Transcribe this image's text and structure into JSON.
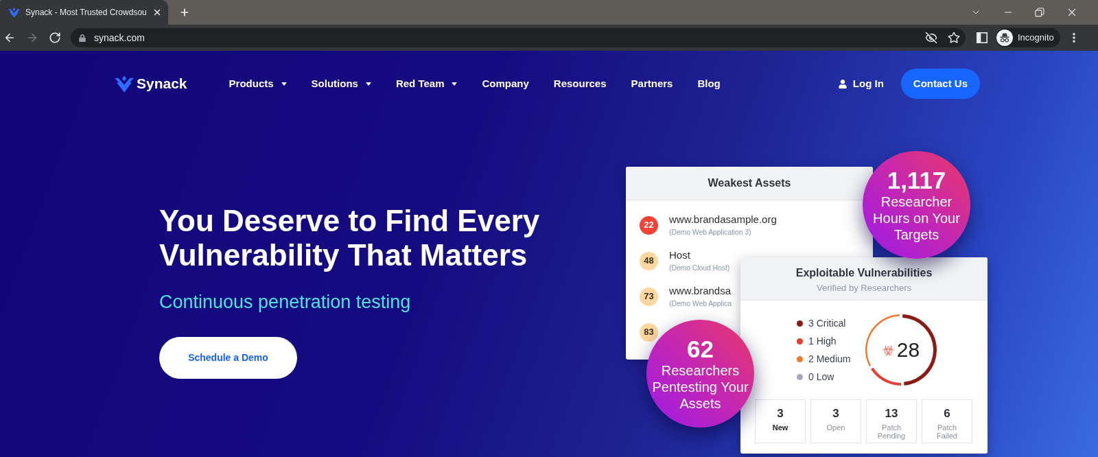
{
  "browser": {
    "tabs": [
      {
        "title": "Synack - Most Trusted Crowdsou",
        "selected": true
      }
    ],
    "nav_buttons": [
      {
        "kind": "back",
        "disabled": false
      },
      {
        "kind": "forward",
        "disabled": true
      },
      {
        "kind": "reload",
        "disabled": false
      }
    ],
    "address": "synack.com",
    "profile": "Incognito"
  },
  "site_nav": {
    "logo": "Synack",
    "links": [
      {
        "label": "Products",
        "dropdown": true
      },
      {
        "label": "Solutions",
        "dropdown": true
      },
      {
        "label": "Red Team",
        "dropdown": true
      },
      {
        "label": "Company",
        "dropdown": false
      },
      {
        "label": "Resources",
        "dropdown": false
      },
      {
        "label": "Partners",
        "dropdown": false
      },
      {
        "label": "Blog",
        "dropdown": false
      }
    ],
    "login": "Log In",
    "cta": "Contact Us"
  },
  "hero": {
    "heading": "You Deserve to Find Every Vulnerability That Matters",
    "subheading": "Continuous penetration testing",
    "button": "Schedule a Demo"
  },
  "weakest_assets": {
    "title": "Weakest Assets",
    "rows": [
      {
        "score": "22",
        "color": "#f44336",
        "name": "www.brandasample.org",
        "detail": "(Demo Web Application 3)"
      },
      {
        "score": "48",
        "color": "#fdd79f",
        "name": "Host",
        "detail": "(Demo Cloud Host)"
      },
      {
        "score": "73",
        "color": "#fdd79f",
        "name": "www.brandsa",
        "detail": "(Demo Web Applica"
      },
      {
        "score": "83",
        "color": "#fdd79f"
      }
    ]
  },
  "researcher_hours": {
    "value": "1,117",
    "label": "Researcher Hours on Your Targets"
  },
  "exploitable_vulnerabilities": {
    "title": "Exploitable Vulnerabilities",
    "subtitle": "Verified by Researchers",
    "legend": [
      {
        "label": "3 Critical",
        "color": "#8a1c14"
      },
      {
        "label": "1 High",
        "color": "#e53e33"
      },
      {
        "label": "2 Medium",
        "color": "#ef7a2f"
      },
      {
        "label": "0 Low",
        "color": "#a3abbb"
      }
    ],
    "total": "28",
    "chart_data": {
      "type": "donut",
      "values": [
        50,
        16.67,
        33.33,
        0
      ]
    },
    "stats": [
      {
        "value": "3",
        "label": "New",
        "selected": true
      },
      {
        "value": "3",
        "label": "Open",
        "selected": false
      },
      {
        "value": "13",
        "label": "Patch Pending",
        "selected": false
      },
      {
        "value": "6",
        "label": "Patch Failed",
        "selected": false
      }
    ]
  },
  "researchers": {
    "value": "62",
    "label": "Researchers Pentesting Your Assets"
  }
}
